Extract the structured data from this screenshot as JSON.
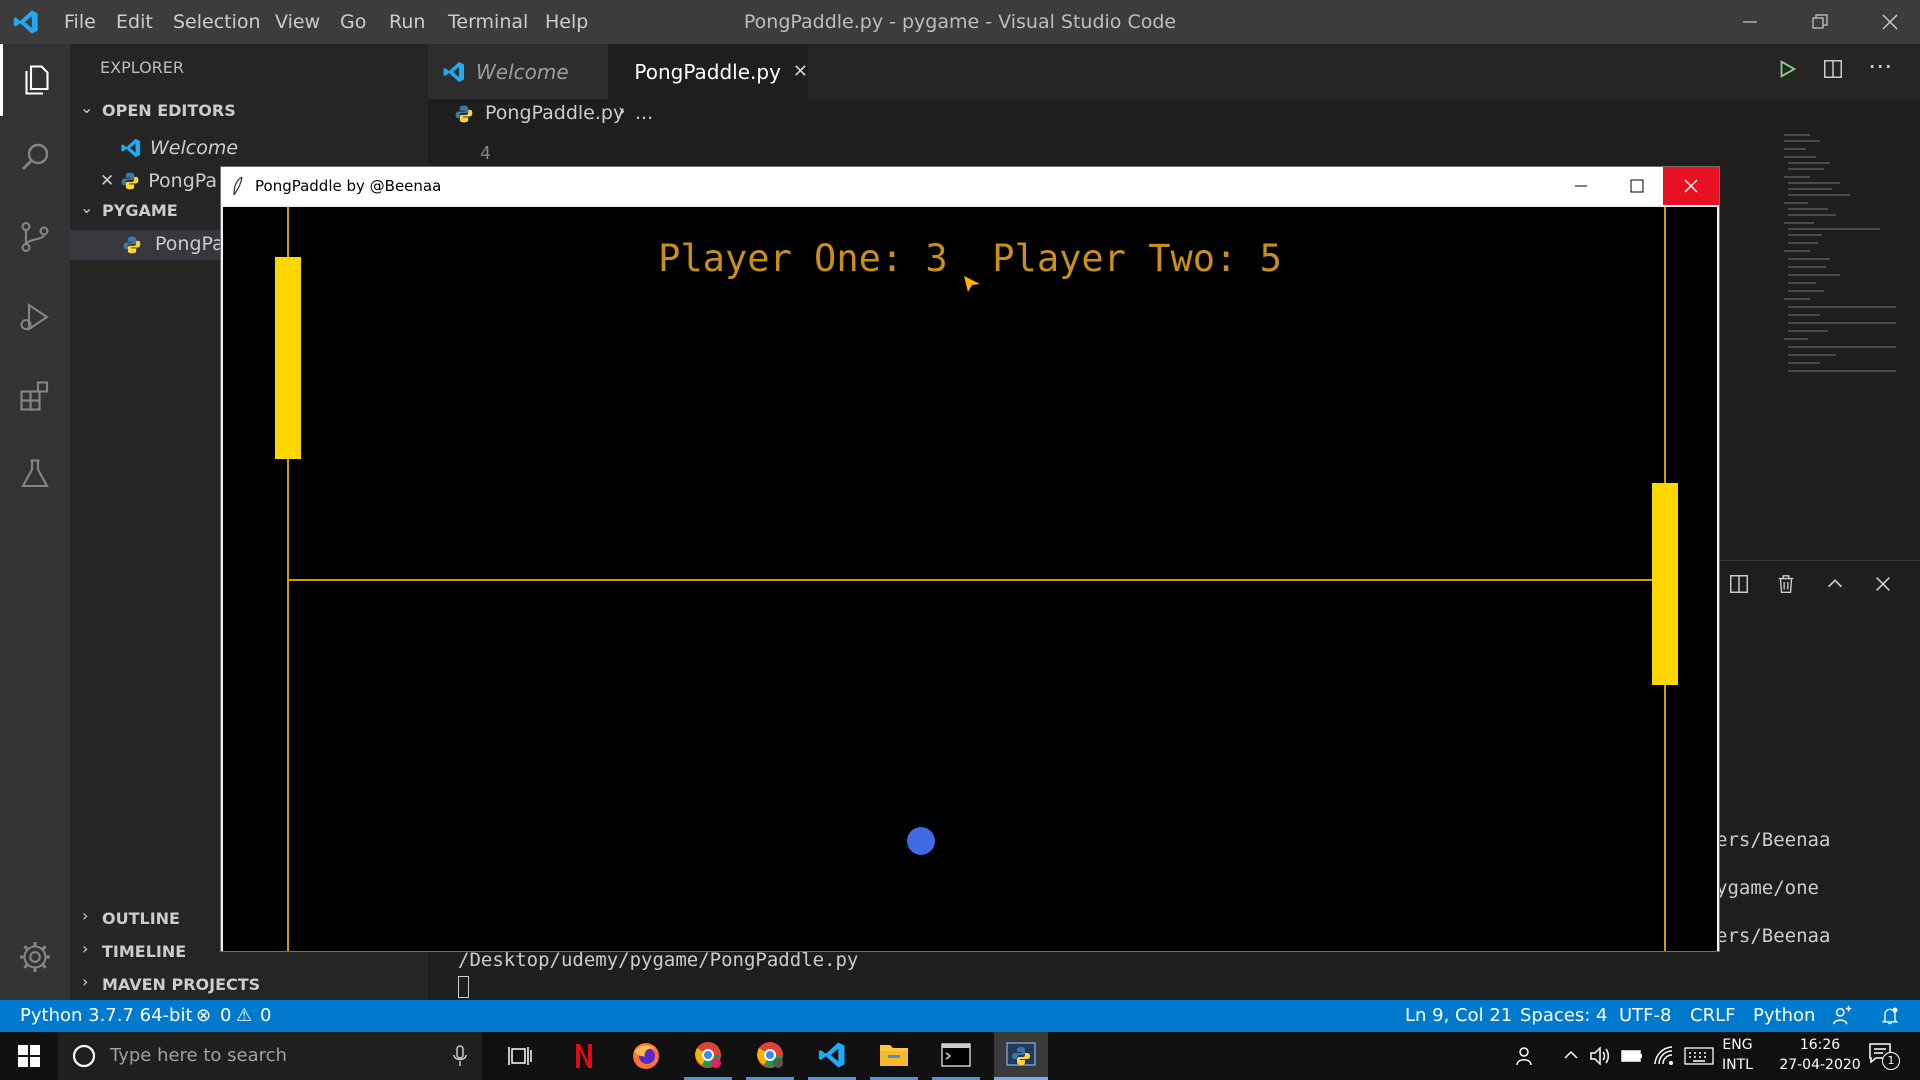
{
  "window": {
    "title": "PongPaddle.py - pygame - Visual Studio Code"
  },
  "menu": [
    "File",
    "Edit",
    "Selection",
    "View",
    "Go",
    "Run",
    "Terminal",
    "Help"
  ],
  "sidebar": {
    "title": "EXPLORER",
    "open_editors": "OPEN EDITORS",
    "open_items": [
      "Welcome",
      "PongPa"
    ],
    "folder": "PYGAME",
    "folder_items": [
      "PongPa"
    ],
    "outline": "OUTLINE",
    "timeline": "TIMELINE",
    "maven": "MAVEN PROJECTS"
  },
  "tabs": [
    "Welcome",
    "PongPaddle.py"
  ],
  "breadcrumb": {
    "file": "PongPaddle.py",
    "rest": "..."
  },
  "editor": {
    "line_number": "4"
  },
  "terminal": {
    "lines": [
      "ers/Beenaa",
      "ygame/one",
      "ers/Beenaa"
    ],
    "path": "/Desktop/udemy/pygame/PongPaddle.py"
  },
  "game": {
    "window_title": "PongPaddle by @Beenaa",
    "score_text": "Player One: 3  Player Two: 5",
    "player_one_score": 3,
    "player_two_score": 5,
    "colors": {
      "paddle": "#ffd700",
      "ball": "#4169e1",
      "line": "#c8a000",
      "score": "#c8901a"
    }
  },
  "status": {
    "python": "Python 3.7.7 64-bit",
    "errors": "0",
    "warnings": "0",
    "position": "Ln 9, Col 21",
    "spaces": "Spaces: 4",
    "encoding": "UTF-8",
    "eol": "CRLF",
    "language": "Python"
  },
  "taskbar": {
    "search_placeholder": "Type here to search",
    "lang_top": "ENG",
    "lang_bottom": "INTL",
    "time": "16:26",
    "date": "27-04-2020",
    "notifications": "1"
  }
}
